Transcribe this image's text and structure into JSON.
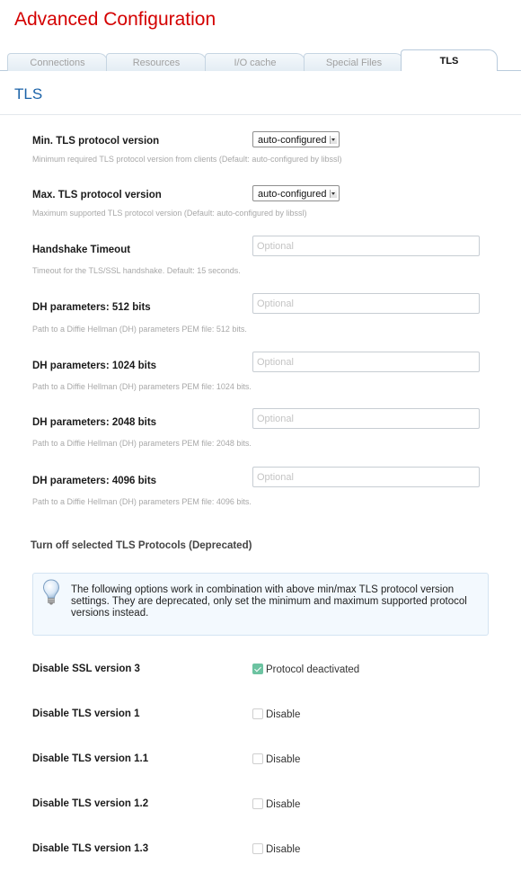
{
  "page": {
    "title": "Advanced Configuration"
  },
  "tabs": [
    {
      "label": "Connections",
      "active": false
    },
    {
      "label": "Resources",
      "active": false
    },
    {
      "label": "I/O cache",
      "active": false
    },
    {
      "label": "Special Files",
      "active": false
    },
    {
      "label": "TLS",
      "active": true
    }
  ],
  "section": {
    "title": "TLS"
  },
  "fields": [
    {
      "label": "Min. TLS protocol version",
      "type": "select",
      "value": "auto-configured",
      "description": "Minimum required TLS protocol version from clients (Default: auto-configured by libssl)"
    },
    {
      "label": "Max. TLS protocol version",
      "type": "select",
      "value": "auto-configured",
      "description": "Maximum supported TLS protocol version (Default: auto-configured by libssl)"
    },
    {
      "label": "Handshake Timeout",
      "type": "input",
      "value": "",
      "placeholder": "Optional",
      "description": "Timeout for the TLS/SSL handshake. Default: 15 seconds."
    },
    {
      "label": "DH parameters: 512 bits",
      "type": "input",
      "value": "",
      "placeholder": "Optional",
      "description": "Path to a Diffie Hellman (DH) parameters PEM file: 512 bits."
    },
    {
      "label": "DH parameters: 1024 bits",
      "type": "input",
      "value": "",
      "placeholder": "Optional",
      "description": "Path to a Diffie Hellman (DH) parameters PEM file: 1024 bits."
    },
    {
      "label": "DH parameters: 2048 bits",
      "type": "input",
      "value": "",
      "placeholder": "Optional",
      "description": "Path to a Diffie Hellman (DH) parameters PEM file: 2048 bits."
    },
    {
      "label": "DH parameters: 4096 bits",
      "type": "input",
      "value": "",
      "placeholder": "Optional",
      "description": "Path to a Diffie Hellman (DH) parameters PEM file: 4096 bits."
    }
  ],
  "deprecated": {
    "heading": "Turn off selected TLS Protocols (Deprecated)",
    "note": "The following options work in combination with above min/max TLS protocol version settings. They are deprecated, only set the minimum and maximum supported protocol versions instead.",
    "note_icon": "lightbulb-icon"
  },
  "checkboxes": [
    {
      "label": "Disable SSL version 3",
      "text": "Protocol deactivated",
      "checked": true
    },
    {
      "label": "Disable TLS version 1",
      "text": "Disable",
      "checked": false
    },
    {
      "label": "Disable TLS version 1.1",
      "text": "Disable",
      "checked": false
    },
    {
      "label": "Disable TLS version 1.2",
      "text": "Disable",
      "checked": false
    },
    {
      "label": "Disable TLS version 1.3",
      "text": "Disable",
      "checked": false
    }
  ],
  "colors": {
    "title": "#d40000",
    "section_title": "#1a62a8",
    "checkbox_checked": "#6cc3a1",
    "note_background": "#f3f9fe"
  }
}
